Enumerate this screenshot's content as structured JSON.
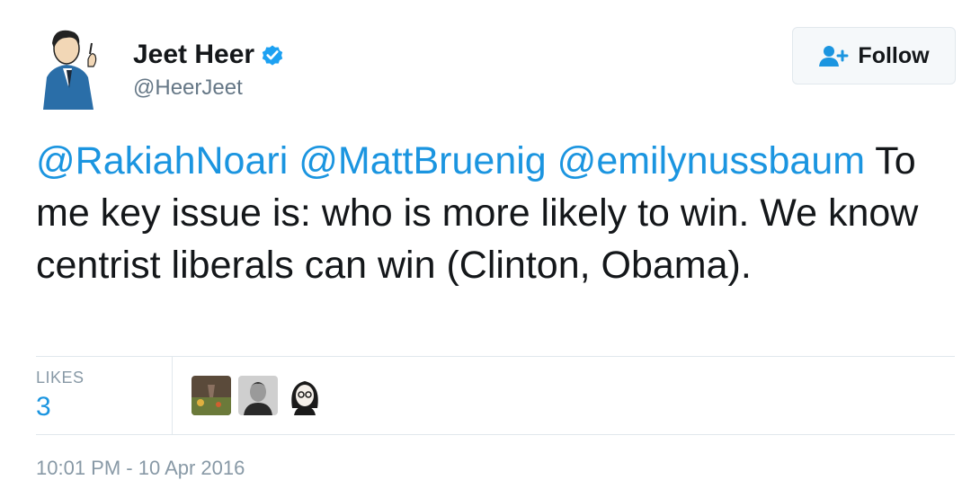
{
  "tweet": {
    "author": {
      "display_name": "Jeet Heer",
      "handle": "@HeerJeet",
      "verified": true,
      "avatar_icon": "cartoon-man-avatar"
    },
    "follow_button": {
      "label": "Follow",
      "icon": "follow-person-plus-icon"
    },
    "body": {
      "mentions": [
        "@RakiahNoari",
        "@MattBruenig",
        "@emilynussbaum"
      ],
      "text": "To me key issue is: who is more likely to win. We know centrist liberals can win (Clinton, Obama)."
    },
    "stats": {
      "likes_label": "LIKES",
      "likes_count": "3"
    },
    "likers": [
      "liker-avatar-1",
      "liker-avatar-2",
      "liker-avatar-3"
    ],
    "timestamp": "10:01 PM - 10 Apr 2016"
  },
  "colors": {
    "link": "#1b95e0",
    "text": "#14171a",
    "muted": "#8899a6",
    "verified": "#1da1f2"
  }
}
